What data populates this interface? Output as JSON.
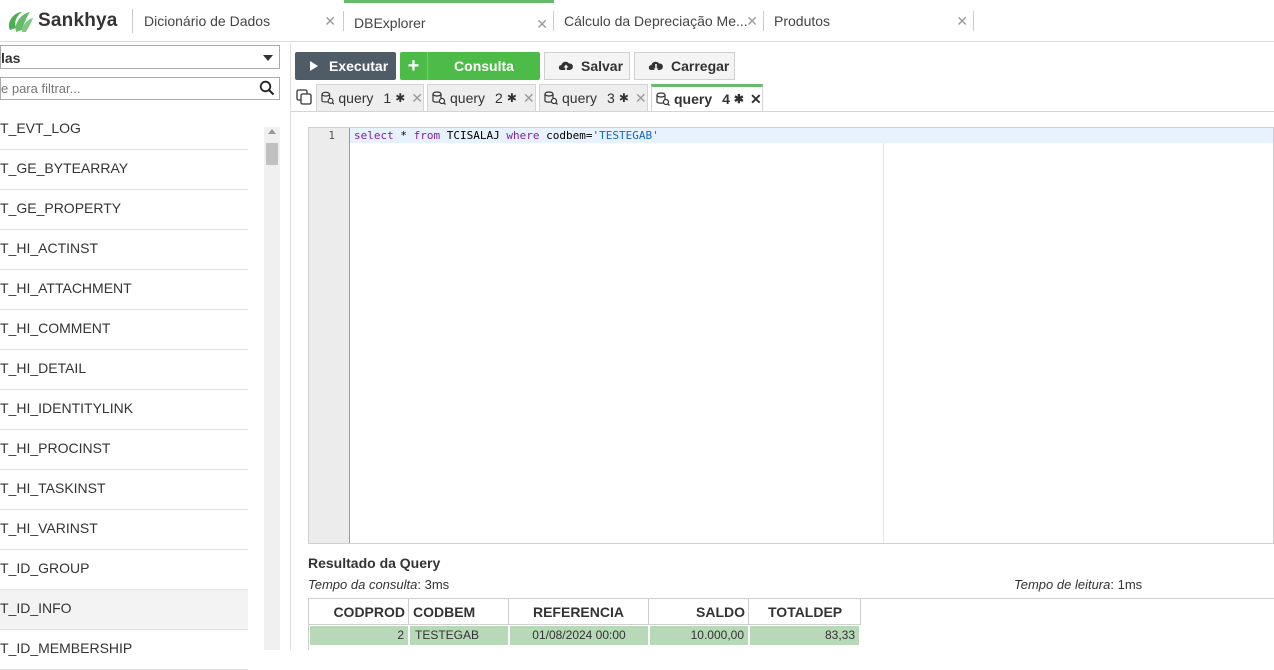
{
  "app": {
    "name": "Sankhya"
  },
  "colors": {
    "accent_green": "#66bb6a",
    "execute_bg": "#4f5b66",
    "consulta_bg": "#4cbb47",
    "result_row_bg": "#b7d9b7"
  },
  "top_tabs": [
    {
      "label": "Dicionário de Dados",
      "active": false
    },
    {
      "label": "DBExplorer",
      "active": true
    },
    {
      "label": "Cálculo da Depreciação Me...",
      "active": false
    },
    {
      "label": "Produtos",
      "active": false
    }
  ],
  "sidebar": {
    "select_value": "las",
    "filter_placeholder": "e para filtrar...",
    "items": [
      "T_EVT_LOG",
      "T_GE_BYTEARRAY",
      "T_GE_PROPERTY",
      "T_HI_ACTINST",
      "T_HI_ATTACHMENT",
      "T_HI_COMMENT",
      "T_HI_DETAIL",
      "T_HI_IDENTITYLINK",
      "T_HI_PROCINST",
      "T_HI_TASKINST",
      "T_HI_VARINST",
      "T_ID_GROUP",
      "T_ID_INFO",
      "T_ID_MEMBERSHIP"
    ],
    "selected_item": "T_ID_INFO"
  },
  "toolbar": {
    "execute_label": "Executar",
    "consulta_label": "Consulta",
    "save_label": "Salvar",
    "load_label": "Carregar"
  },
  "query_tabs": [
    {
      "label": "query",
      "number": "1",
      "active": false
    },
    {
      "label": "query",
      "number": "2",
      "active": false
    },
    {
      "label": "query",
      "number": "3",
      "active": false
    },
    {
      "label": "query",
      "number": "4",
      "active": true
    }
  ],
  "editor": {
    "line_number": "1",
    "sql": {
      "select_kw": "select",
      "part1": " * ",
      "from_kw": "from",
      "table": " TCISALAJ ",
      "where_kw": "where",
      "cond": " codbem=",
      "value": "'TESTEGAB'"
    }
  },
  "result": {
    "title": "Resultado da Query",
    "query_time_label": "Tempo da consulta",
    "query_time_value": ": 3ms",
    "read_time_label": "Tempo de leitura",
    "read_time_value": ": 1ms",
    "columns": [
      "CODPROD",
      "CODBEM",
      "REFERENCIA",
      "SALDO",
      "TOTALDEP"
    ],
    "rows": [
      [
        "2",
        "TESTEGAB",
        "01/08/2024 00:00",
        "10.000,00",
        "83,33"
      ]
    ]
  }
}
